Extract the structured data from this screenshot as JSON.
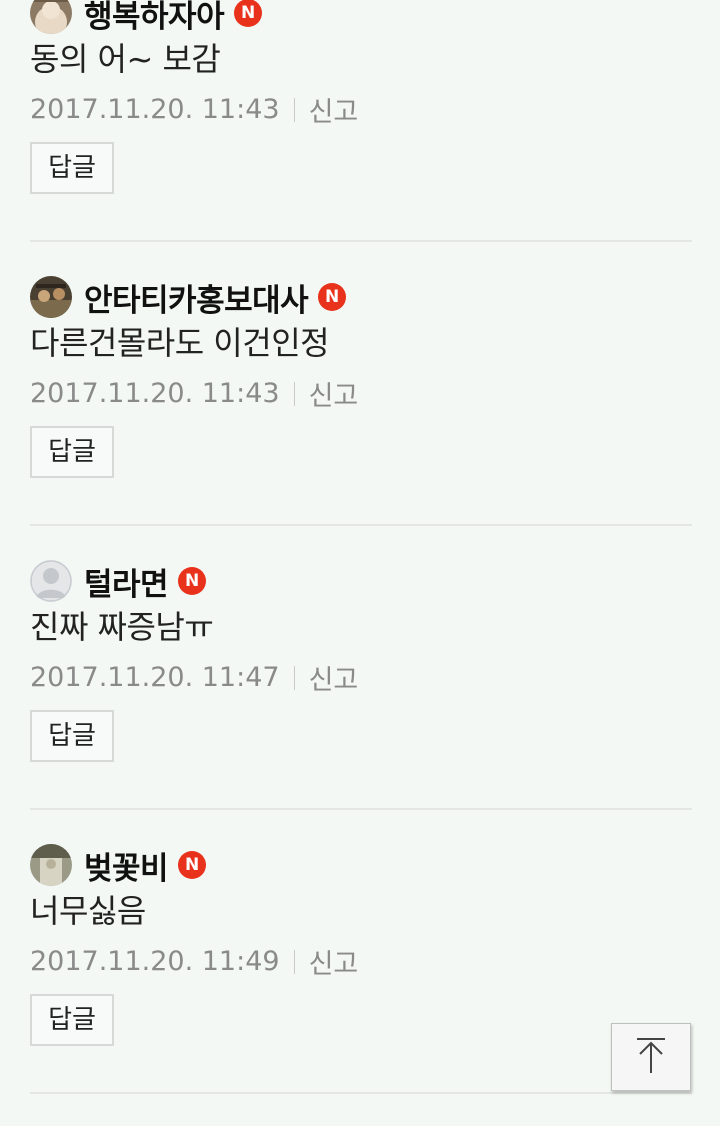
{
  "comments": [
    {
      "author": "행복하자아",
      "badge": "N",
      "text": "동의 어~ 보감",
      "date": "2017.11.20. 11:43",
      "report_label": "신고",
      "reply_label": "답글"
    },
    {
      "author": "안타티카홍보대사",
      "badge": "N",
      "text": "다른건몰라도 이건인정",
      "date": "2017.11.20. 11:43",
      "report_label": "신고",
      "reply_label": "답글"
    },
    {
      "author": "털라면",
      "badge": "N",
      "text": "진짜 짜증남ㅠ",
      "date": "2017.11.20. 11:47",
      "report_label": "신고",
      "reply_label": "답글"
    },
    {
      "author": "벚꽃비",
      "badge": "N",
      "text": "너무싫음",
      "date": "2017.11.20. 11:49",
      "report_label": "신고",
      "reply_label": "답글"
    }
  ],
  "scroll_top_icon": "arrow-up-to-top-icon",
  "colors": {
    "background": "#f3f8f4",
    "new_badge": "#e8321c",
    "meta_text": "#8a8a8a"
  }
}
